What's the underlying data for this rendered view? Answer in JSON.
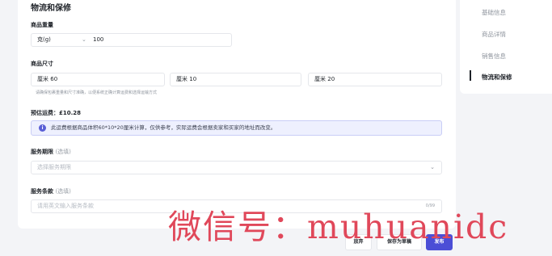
{
  "section": {
    "title": "物流和保修"
  },
  "weight": {
    "label": "商品重量",
    "unit": "克(g)",
    "value": "100"
  },
  "size": {
    "label": "商品尺寸",
    "fields": [
      {
        "unit": "厘米",
        "value": "60"
      },
      {
        "unit": "厘米",
        "value": "10"
      },
      {
        "unit": "厘米",
        "value": "20"
      }
    ],
    "hint": "请确保包裹重量和尺寸准确，以便系统正确计算运费和选择运输方式"
  },
  "shipping": {
    "label": "预估运费：",
    "value": "£10.28",
    "notice": "此运费根据商品体积60*10*20厘米计算，仅供参考，实际运费会根据卖家和买家的地址而改变。"
  },
  "service_period": {
    "label": "服务期限",
    "optional": "(选填)",
    "placeholder": "选择服务期限"
  },
  "service_terms": {
    "label": "服务条款",
    "optional": "(选填)",
    "placeholder": "请用英文输入服务条款",
    "counter": "0/99"
  },
  "side_nav": {
    "items": [
      "基础信息",
      "商品详情",
      "销售信息",
      "物流和保修"
    ],
    "active_index": 3
  },
  "footer": {
    "discard": "放弃",
    "save_draft": "保存为草稿",
    "publish": "发布"
  },
  "watermark": {
    "text": "微信号：muhuanidc"
  }
}
